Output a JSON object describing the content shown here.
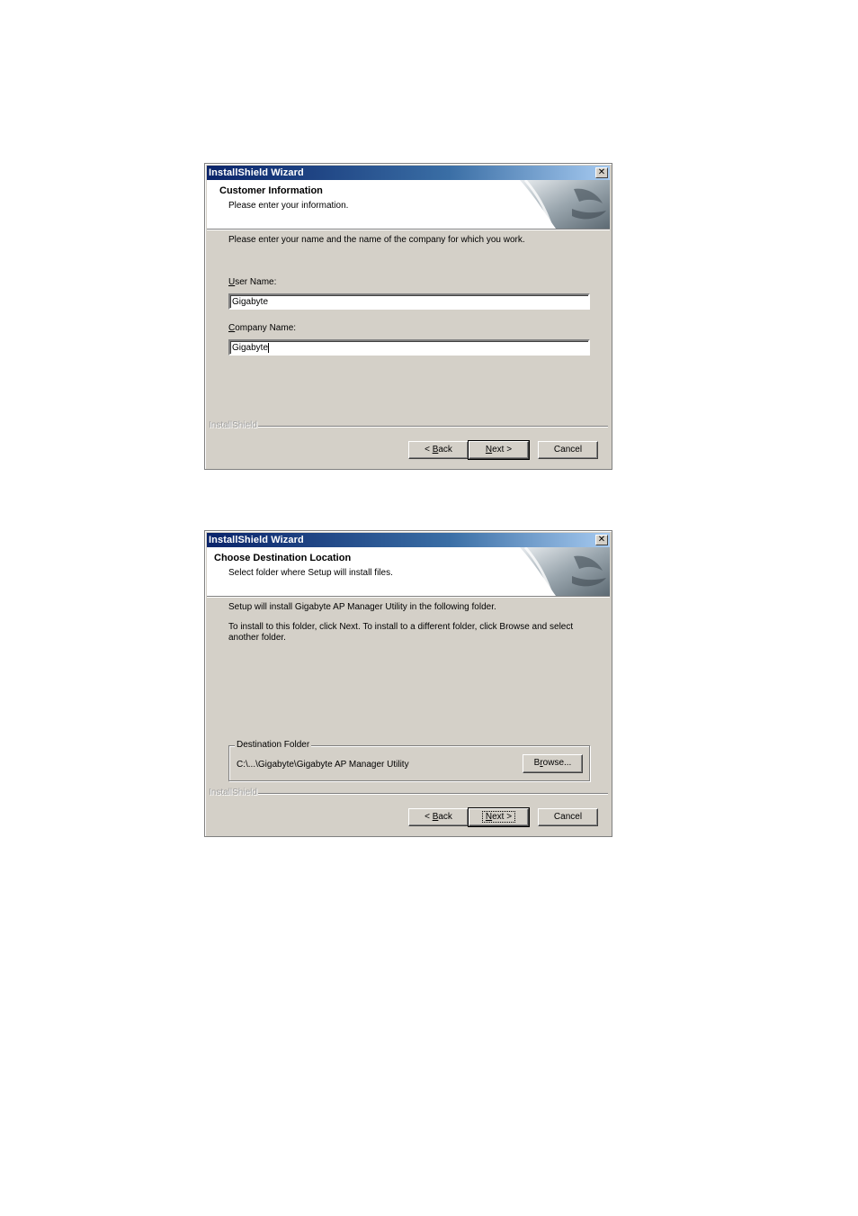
{
  "dialog1": {
    "title": "InstallShield Wizard",
    "close_glyph": "✕",
    "header_title": "Customer Information",
    "header_subtitle": "Please enter your information.",
    "instruction": "Please enter your name and the name of the company for which you work.",
    "user_name_label_accel": "U",
    "user_name_label_rest": "ser Name:",
    "user_name_value": "Gigabyte",
    "company_name_label_accel": "C",
    "company_name_label_rest": "ompany Name:",
    "company_name_value": "Gigabyte",
    "brand": "InstallShield",
    "back_prefix": "< ",
    "back_accel": "B",
    "back_rest": "ack",
    "next_accel": "N",
    "next_rest": "ext >",
    "cancel": "Cancel"
  },
  "dialog2": {
    "title": "InstallShield Wizard",
    "close_glyph": "✕",
    "header_title": "Choose Destination Location",
    "header_subtitle": "Select folder where Setup will install files.",
    "line1": "Setup will install Gigabyte AP Manager Utility in the following folder.",
    "line2": "To install to this folder, click Next. To install to a different folder, click Browse and select another folder.",
    "group_label": "Destination Folder",
    "folder_path": "C:\\...\\Gigabyte\\Gigabyte AP Manager Utility",
    "browse_accel": "r",
    "browse_prefix": "B",
    "browse_rest": "owse...",
    "brand": "InstallShield",
    "back_prefix": "< ",
    "back_accel": "B",
    "back_rest": "ack",
    "next_accel": "N",
    "next_rest": "ext >",
    "cancel": "Cancel"
  },
  "colors": {
    "title_gradient_start": "#0a246a",
    "title_gradient_end": "#a6caf0",
    "dialog_face": "#d4d0c8",
    "header_bg": "#ffffff"
  },
  "icons": {
    "header_art": "installshield-face-art-icon",
    "close": "close-icon"
  }
}
